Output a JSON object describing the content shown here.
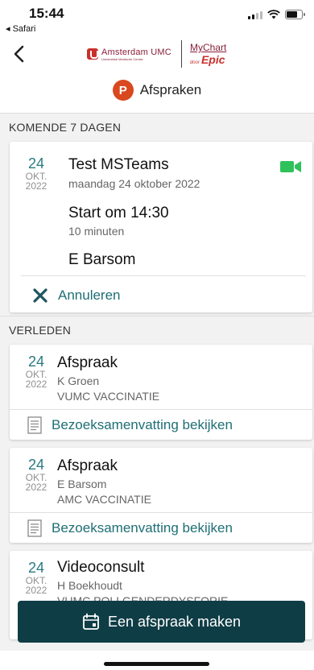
{
  "status_bar": {
    "time": "15:44",
    "back_app": "◂ Safari"
  },
  "header": {
    "back_icon": "chevron-left-icon",
    "hospital_logo": "Amsterdam UMC",
    "hospital_logo_sub": "Universitair Medische Centra",
    "app_logo": "MyChart",
    "app_logo_door": "door",
    "app_logo_vendor": "Epic",
    "title_badge": "P",
    "page_title": "Afspraken",
    "accent_color": "#d9481f"
  },
  "upcoming": {
    "section_label": "KOMENDE 7 DAGEN",
    "appointments": [
      {
        "day": "24",
        "month": "OKT.",
        "year": "2022",
        "title": "Test MSTeams",
        "date_text": "maandag 24 oktober 2022",
        "start": "Start om 14:30",
        "duration": "10 minuten",
        "provider": "E Barsom",
        "video_icon": "video-camera-icon",
        "action_label": "Annuleren"
      }
    ]
  },
  "past": {
    "section_label": "VERLEDEN",
    "appointments": [
      {
        "day": "24",
        "month": "OKT.",
        "year": "2022",
        "title": "Afspraak",
        "provider": "K Groen",
        "department": "VUMC VACCINATIE",
        "action_label": "Bezoeksamenvatting bekijken"
      },
      {
        "day": "24",
        "month": "OKT.",
        "year": "2022",
        "title": "Afspraak",
        "provider": "E Barsom",
        "department": "AMC VACCINATIE",
        "action_label": "Bezoeksamenvatting bekijken"
      },
      {
        "day": "24",
        "month": "OKT.",
        "year": "2022",
        "title": "Videoconsult",
        "provider": "H Boekhoudt",
        "department": "VUMC POLI GENDERDYSFORIE"
      }
    ]
  },
  "cta": {
    "label": "Een afspraak maken",
    "icon": "calendar-icon"
  },
  "colors": {
    "teal_link": "#1e6f75",
    "cta_background": "#0f3d46",
    "video_green": "#2fc25b"
  }
}
